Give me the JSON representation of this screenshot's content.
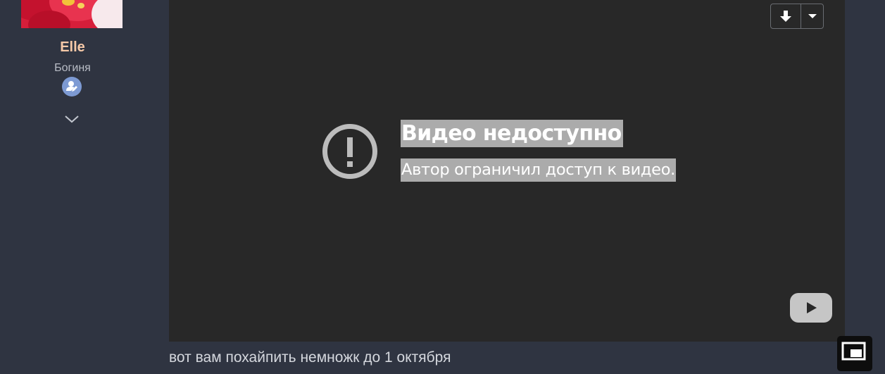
{
  "user": {
    "name": "Elle",
    "title": "Богиня",
    "badge_icon": "user-pen-icon",
    "expand_icon": "chevron-down-icon"
  },
  "video": {
    "error_title": "Видео недоступно",
    "error_message": "Автор ограничил доступ к видео.",
    "error_icon": "exclamation-circle-icon",
    "download_icon": "download-arrow-icon",
    "dropdown_icon": "caret-down-icon",
    "logo_icon": "youtube-play-icon",
    "pip_icon": "picture-in-picture-icon"
  },
  "post": {
    "text": "вот вам похайпить немножк до 1 октября"
  },
  "colors": {
    "page_background": "#2f3441",
    "video_background": "#282828",
    "username": "#f6c9a8",
    "badge": "#7d9ad3",
    "text_highlight": "#ababab"
  }
}
